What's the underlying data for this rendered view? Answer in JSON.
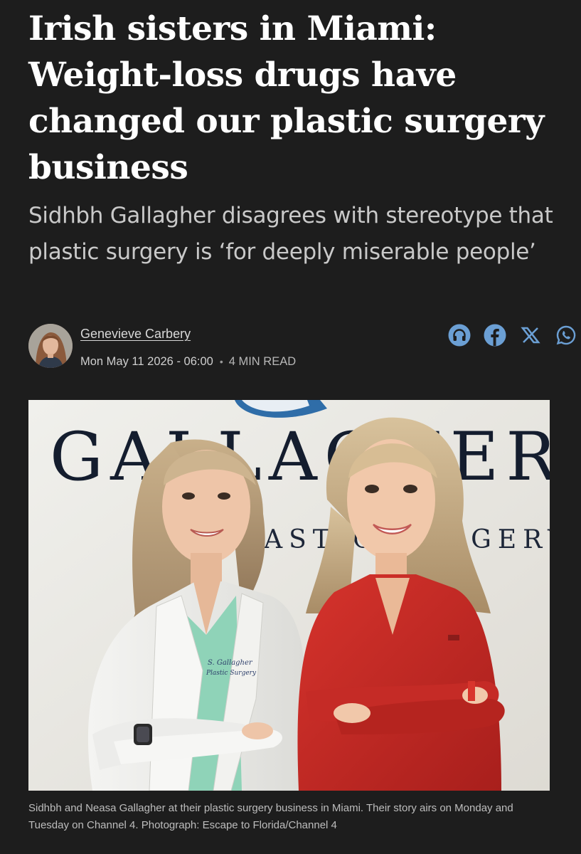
{
  "article": {
    "headline": "Irish sisters in Miami: Weight-loss drugs have changed our plastic surgery business",
    "standfirst": "Sidhbh Gallagher disagrees with stereotype that plastic surgery is ‘for deeply miserable people’"
  },
  "byline": {
    "author": "Genevieve Carbery",
    "date": "Mon May 11 2026 - 06:00",
    "separator": "•",
    "read_time": "4 MIN READ"
  },
  "share": {
    "items": [
      {
        "icon": "headphones-icon",
        "label": "Listen"
      },
      {
        "icon": "facebook-icon",
        "label": "Facebook"
      },
      {
        "icon": "x-icon",
        "label": "X"
      },
      {
        "icon": "whatsapp-icon",
        "label": "WhatsApp"
      }
    ],
    "accent": "#6b9fd4"
  },
  "photo": {
    "sign_text": "GALLAGHER",
    "sign_subtext": "PLASTIC SURGERY",
    "coat_embroidery_line1": "S. Gallagher",
    "coat_embroidery_line2": "Plastic Surgery"
  },
  "caption": "Sidhbh and Neasa Gallagher at their plastic surgery business in Miami. Their story airs on Monday and Tuesday on Channel 4. Photograph: Escape to Florida/Channel 4"
}
